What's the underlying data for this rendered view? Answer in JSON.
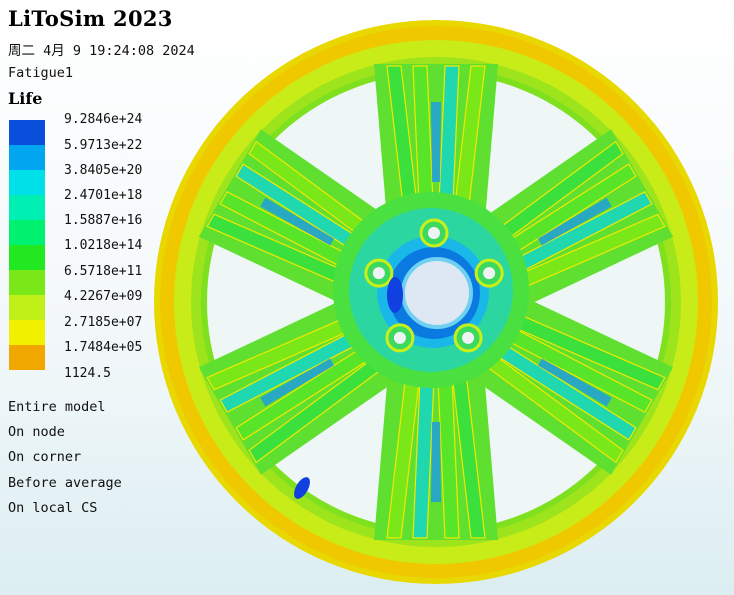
{
  "header": {
    "app_title": "LiToSim 2023",
    "timestamp": "周二 4月 9 19:24:08 2024",
    "analysis_name": "Fatigue1"
  },
  "legend": {
    "title": "Life",
    "labels": [
      "9.2846e+24",
      "5.9713e+22",
      "3.8405e+20",
      "2.4701e+18",
      "1.5887e+16",
      "1.0218e+14",
      "6.5718e+11",
      "4.2267e+09",
      "2.7185e+07",
      "1.7484e+05",
      "1124.5"
    ],
    "colors": [
      "#0a4fdc",
      "#00a6f0",
      "#00e0e8",
      "#00f0b4",
      "#00f070",
      "#22e822",
      "#7ae818",
      "#c0f018",
      "#f0f000",
      "#f0a800",
      "#f05000"
    ]
  },
  "info_lines": [
    "Entire model",
    "On node",
    "On corner",
    "Before average",
    "On local CS"
  ],
  "viewport": {
    "object": "wheel-rim-fatigue-contour",
    "spoke_count": 6,
    "lug_hole_count": 5
  }
}
